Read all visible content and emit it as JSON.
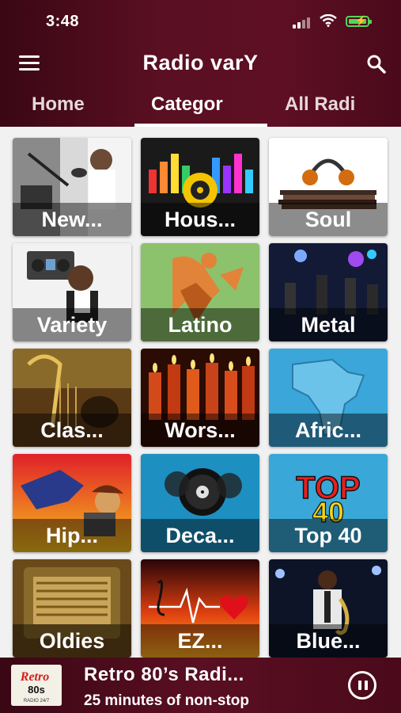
{
  "status": {
    "time": "3:48"
  },
  "header": {
    "title": "Radio varY"
  },
  "tabs": [
    {
      "label": "Home"
    },
    {
      "label": "Categor"
    },
    {
      "label": "All Radi"
    }
  ],
  "categories": [
    {
      "label": "New...",
      "icon": "studio-microphone"
    },
    {
      "label": "Hous...",
      "icon": "speaker-equalizer"
    },
    {
      "label": "Soul",
      "icon": "headphones-records"
    },
    {
      "label": "Variety",
      "icon": "boombox"
    },
    {
      "label": "Latino",
      "icon": "dancers"
    },
    {
      "label": "Metal",
      "icon": "concert"
    },
    {
      "label": "Clas...",
      "icon": "harp"
    },
    {
      "label": "Wors...",
      "icon": "candles"
    },
    {
      "label": "Afric...",
      "icon": "africa-map"
    },
    {
      "label": "Hip...",
      "icon": "breakdancer"
    },
    {
      "label": "Deca...",
      "icon": "vinyl-records"
    },
    {
      "label": "Top 40",
      "icon": "top-40"
    },
    {
      "label": "Oldies",
      "icon": "vintage-radio"
    },
    {
      "label": "EZ...",
      "icon": "heartbeat"
    },
    {
      "label": "Blue...",
      "icon": "saxophonist"
    }
  ],
  "player": {
    "title": "Retro 80’s Radi...",
    "subtitle": "25 minutes of non-stop",
    "logo": {
      "line1": "Retro",
      "line2": "80s",
      "line3": "RADIO 24/7"
    }
  },
  "top40": {
    "line1": "TOP",
    "line2": "40"
  },
  "colors": {
    "header": "#5a0f22",
    "accent": "#ffffff"
  }
}
